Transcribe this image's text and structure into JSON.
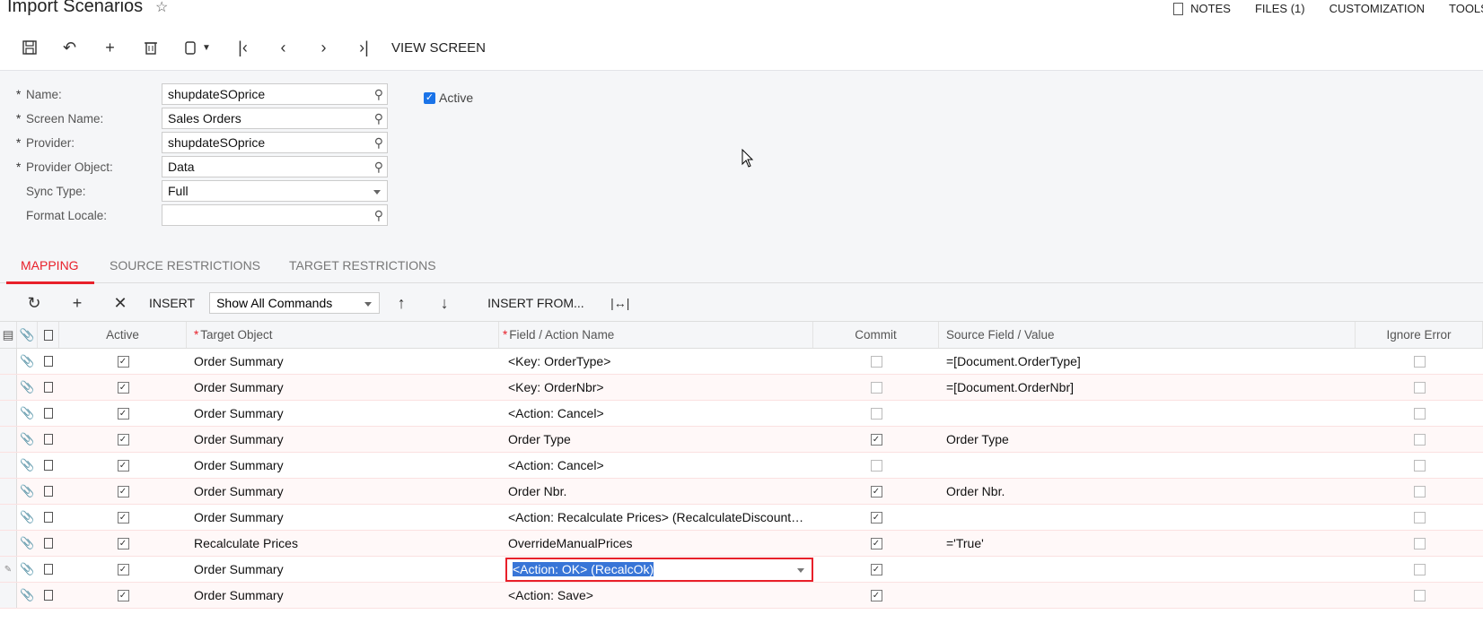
{
  "header": {
    "title": "Import Scenarios",
    "right_menu": [
      "NOTES",
      "FILES (1)",
      "CUSTOMIZATION",
      "TOOLS"
    ]
  },
  "toolbar": {
    "buttons": [
      "save-icon",
      "undo-icon",
      "add-icon",
      "delete-icon",
      "clipboard-icon",
      "first-record-icon",
      "prev-record-icon",
      "next-record-icon",
      "last-record-icon"
    ],
    "view_screen_label": "VIEW SCREEN"
  },
  "form": {
    "fields": [
      {
        "label": "Name:",
        "required": true,
        "value": "shupdateSOprice",
        "control": "lookup"
      },
      {
        "label": "Screen Name:",
        "required": true,
        "value": "Sales Orders",
        "control": "lookup"
      },
      {
        "label": "Provider:",
        "required": true,
        "value": "shupdateSOprice",
        "control": "lookup"
      },
      {
        "label": "Provider Object:",
        "required": true,
        "value": "Data",
        "control": "lookup"
      },
      {
        "label": "Sync Type:",
        "required": false,
        "value": "Full",
        "control": "dropdown"
      },
      {
        "label": "Format Locale:",
        "required": false,
        "value": "",
        "control": "lookup"
      }
    ],
    "active": {
      "label": "Active",
      "checked": true
    }
  },
  "tabs": [
    {
      "label": "MAPPING",
      "active": true
    },
    {
      "label": "SOURCE RESTRICTIONS",
      "active": false
    },
    {
      "label": "TARGET RESTRICTIONS",
      "active": false
    }
  ],
  "grid_toolbar": {
    "insert_label": "INSERT",
    "filter_value": "Show All Commands",
    "insert_from_label": "INSERT FROM..."
  },
  "grid": {
    "columns": [
      "Active",
      "Target Object",
      "Field / Action Name",
      "Commit",
      "Source Field / Value",
      "Ignore Error"
    ],
    "required_columns": [
      "Target Object",
      "Field / Action Name"
    ],
    "rows": [
      {
        "active": true,
        "target": "Order Summary",
        "field": "<Key: OrderType>",
        "commit": false,
        "source": "=[Document.OrderType]",
        "ignore": false
      },
      {
        "active": true,
        "target": "Order Summary",
        "field": "<Key: OrderNbr>",
        "commit": false,
        "source": "=[Document.OrderNbr]",
        "ignore": false
      },
      {
        "active": true,
        "target": "Order Summary",
        "field": "<Action: Cancel>",
        "commit": false,
        "source": "",
        "ignore": false
      },
      {
        "active": true,
        "target": "Order Summary",
        "field": "Order Type",
        "commit": true,
        "source": "Order Type",
        "ignore": false
      },
      {
        "active": true,
        "target": "Order Summary",
        "field": "<Action: Cancel>",
        "commit": false,
        "source": "",
        "ignore": false
      },
      {
        "active": true,
        "target": "Order Summary",
        "field": "Order Nbr.",
        "commit": true,
        "source": "Order Nbr.",
        "ignore": false
      },
      {
        "active": true,
        "target": "Order Summary",
        "field": "<Action: Recalculate Prices> (RecalculateDiscount…",
        "commit": true,
        "source": "",
        "ignore": false
      },
      {
        "active": true,
        "target": "Recalculate Prices",
        "field": "OverrideManualPrices",
        "commit": true,
        "source": "='True'",
        "ignore": false
      },
      {
        "active": true,
        "target": "Order Summary",
        "field": "<Action: OK> (RecalcOk)",
        "commit": true,
        "source": "",
        "ignore": false,
        "editing": true
      },
      {
        "active": true,
        "target": "Order Summary",
        "field": "<Action: Save>",
        "commit": true,
        "source": "",
        "ignore": false
      }
    ]
  }
}
